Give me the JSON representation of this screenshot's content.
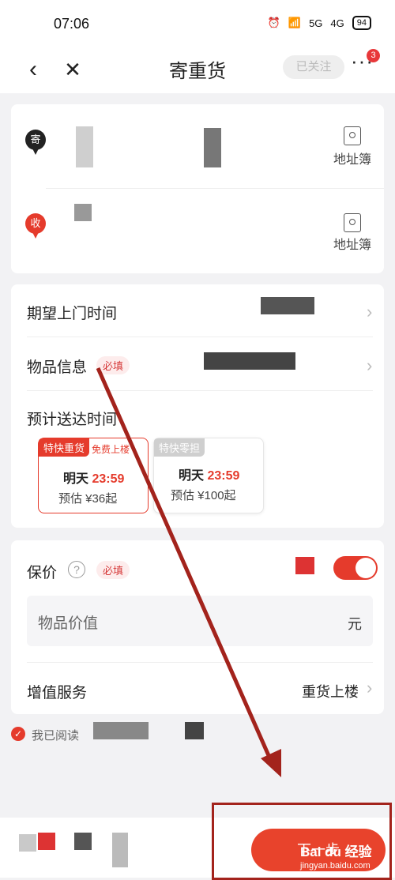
{
  "status_bar": {
    "time": "07:06",
    "network_5g": "5G",
    "network_4g": "4G",
    "battery": "94"
  },
  "nav": {
    "title": "寄重货",
    "follow_label": "已关注",
    "more_badge": "3"
  },
  "address": {
    "sender_pin": "寄",
    "receiver_pin": "收",
    "address_book_label": "地址簿"
  },
  "details": {
    "pickup_time_label": "期望上门时间",
    "item_info_label": "物品信息",
    "required_tag": "必填",
    "eta_label": "预计送达时间",
    "options": [
      {
        "tag": "特快重货",
        "sub_tag": "免费上楼",
        "day": "明天",
        "time": "23:59",
        "estimate": "预估 ¥36起"
      },
      {
        "tag": "特快零担",
        "day": "明天",
        "time": "23:59",
        "estimate": "预估 ¥100起"
      }
    ]
  },
  "insurance": {
    "label": "保价",
    "required_tag": "必填",
    "item_value_placeholder": "物品价值",
    "unit": "元",
    "value_added_label": "增值服务",
    "value_added_value": "重货上楼"
  },
  "agreement": {
    "text": "我已阅读"
  },
  "bottom": {
    "next_label": "下一步"
  },
  "watermark": {
    "brand": "Bai du 经验",
    "url": "jingyan.baidu.com"
  },
  "colors": {
    "accent": "#e53b2c",
    "annotation": "#a3231c",
    "background": "#f2f2f4"
  }
}
